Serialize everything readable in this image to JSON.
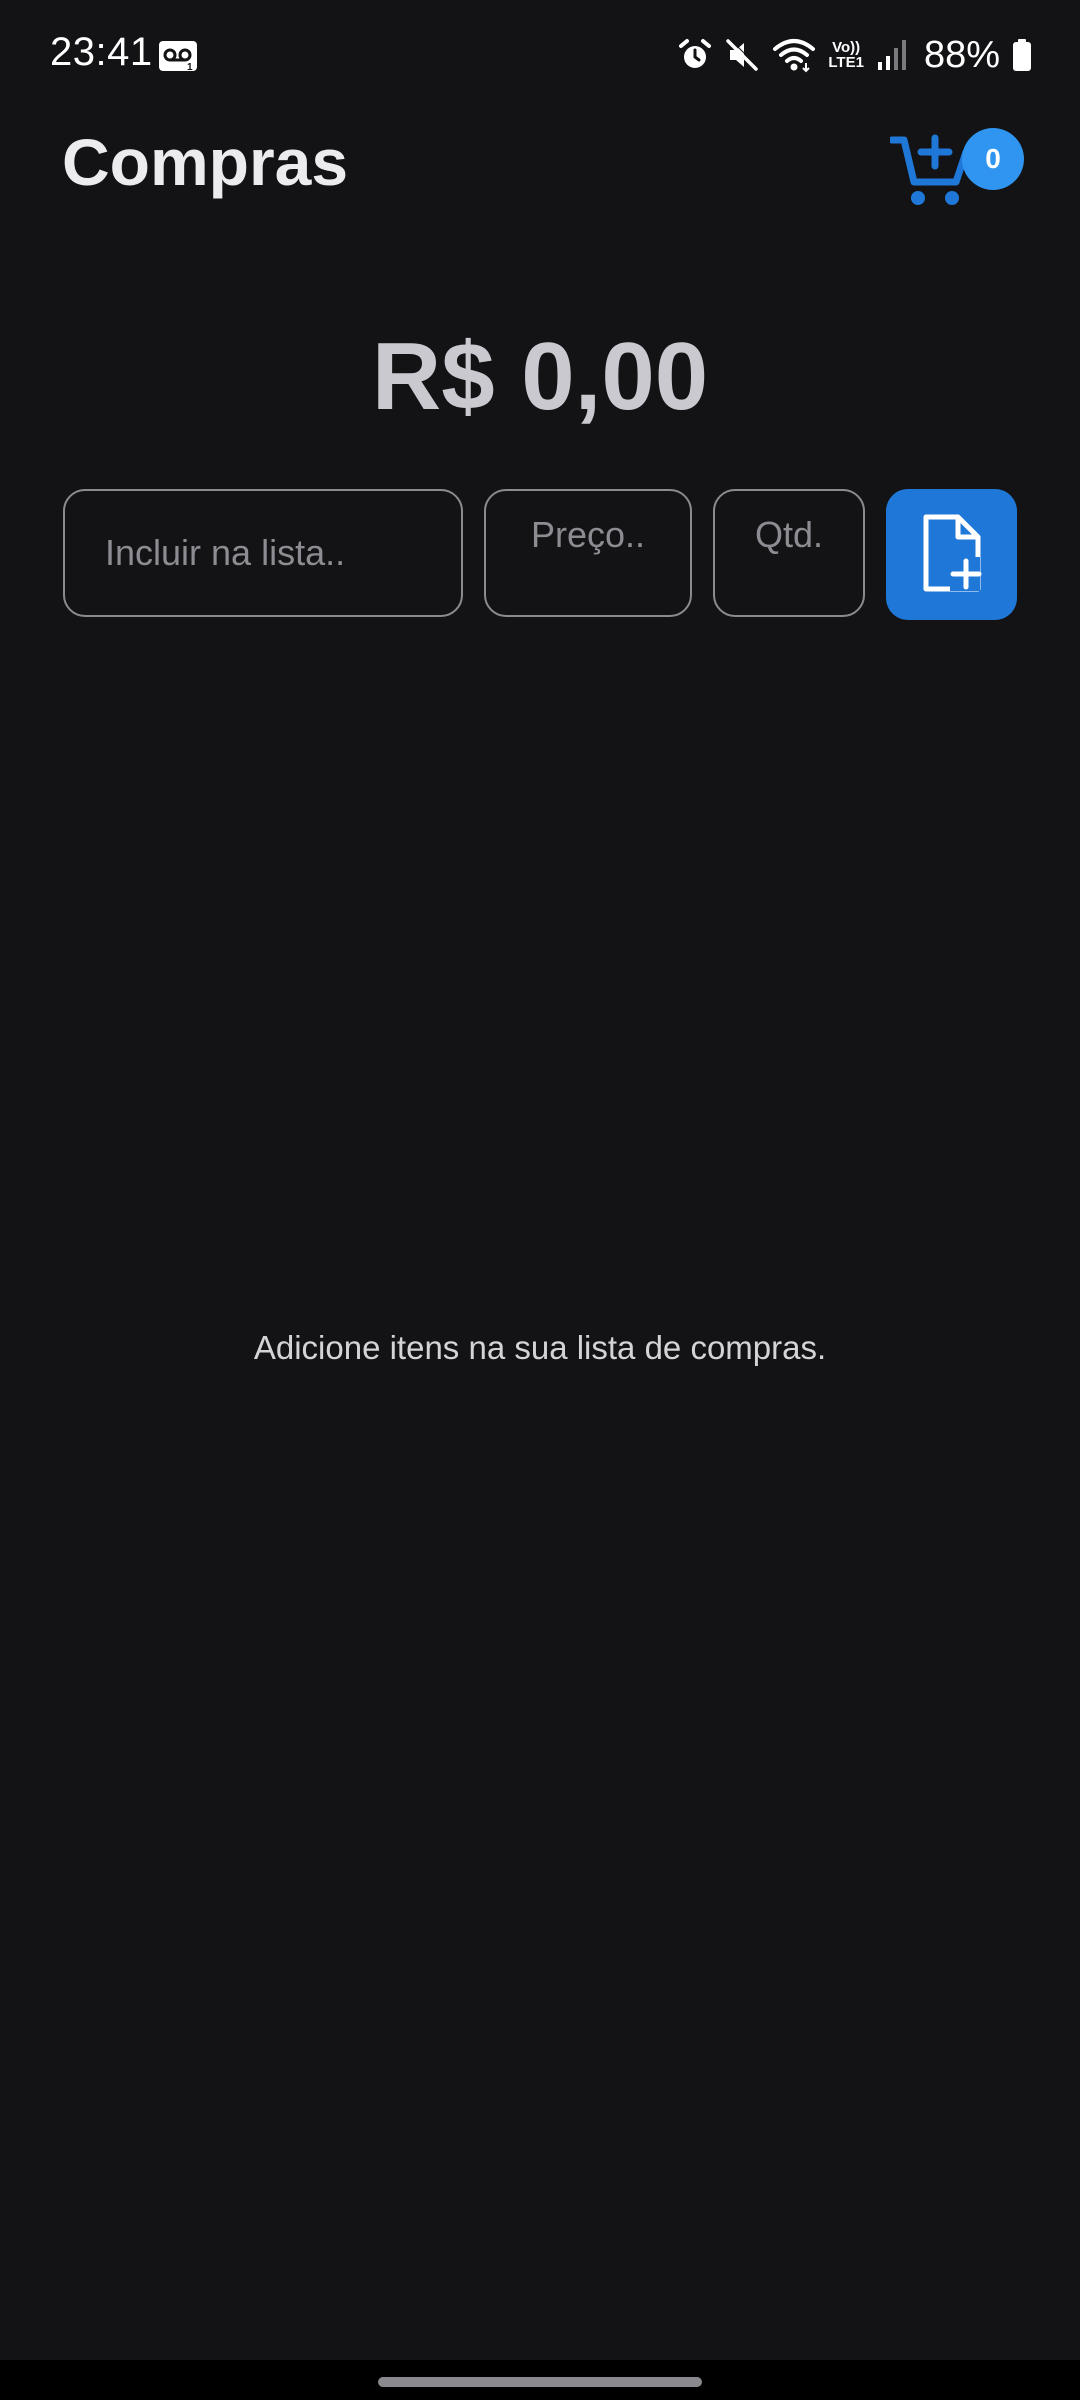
{
  "status_bar": {
    "time": "23:41",
    "battery": "88%",
    "icons": [
      "voicemail-icon",
      "alarm-icon",
      "mute-icon",
      "wifi-icon",
      "volte-lte-icon",
      "signal-icon",
      "battery-icon"
    ],
    "lte_label": "LTE1",
    "volte_label": "Vo))"
  },
  "header": {
    "title": "Compras",
    "cart_icon": "cart-plus-icon",
    "cart_count": "0"
  },
  "total": {
    "amount": "R$ 0,00"
  },
  "form": {
    "item_placeholder": "Incluir na lista..",
    "item_value": "",
    "price_placeholder": "Preço..",
    "price_value": "",
    "qty_placeholder": "Qtd.",
    "qty_value": "",
    "add_icon": "file-plus-icon"
  },
  "list": {
    "empty_message": "Adicione itens na sua lista de compras."
  },
  "colors": {
    "background": "#131315",
    "accent": "#1f78d8",
    "badge": "#2f95f0",
    "total_text": "#c9c9cf"
  }
}
